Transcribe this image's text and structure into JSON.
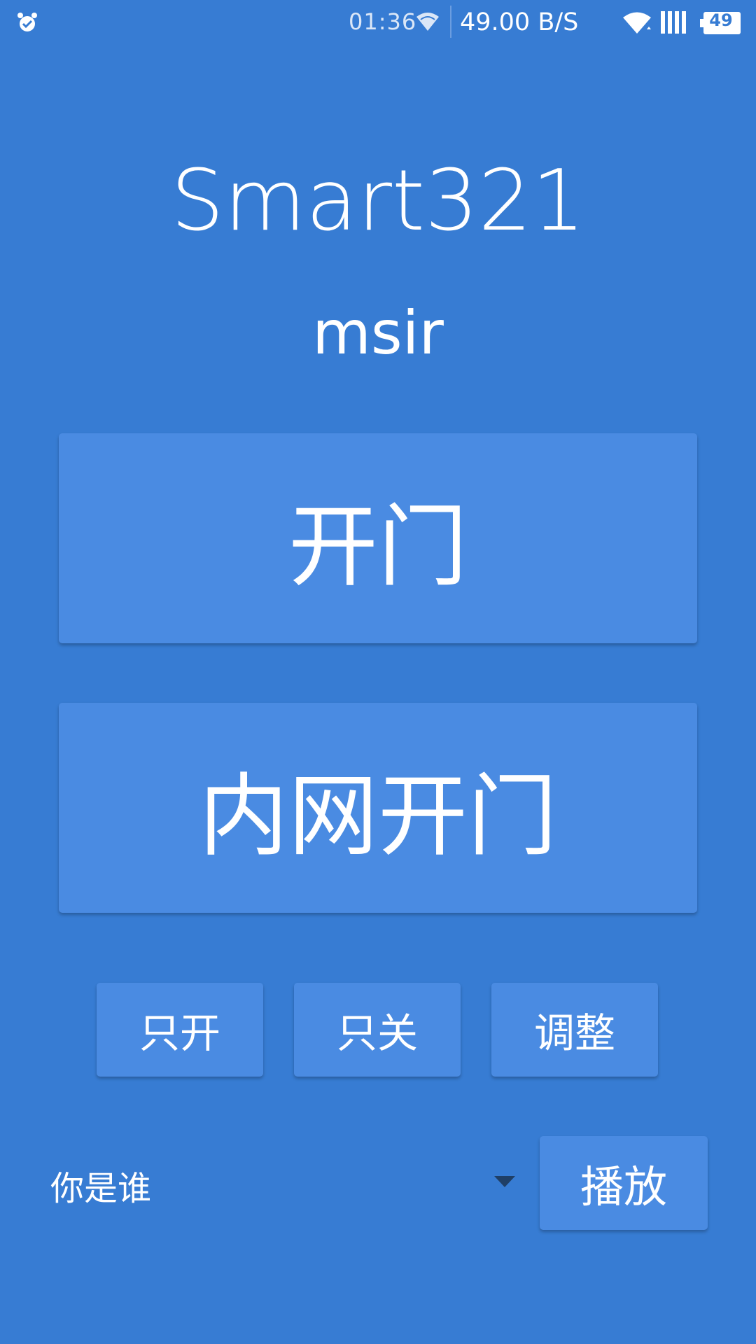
{
  "status_bar": {
    "time": "01:36",
    "network_speed": "49.00 B/S",
    "battery_level": "49",
    "icons": [
      "alarm-icon",
      "wifi-icon",
      "wifi-icon",
      "signal-icon",
      "battery-icon"
    ]
  },
  "header": {
    "title": "Smart321",
    "subtitle": "msir"
  },
  "actions": {
    "open_door": "开门",
    "intranet_open_door": "内网开门",
    "only_open": "只开",
    "only_close": "只关",
    "adjust": "调整"
  },
  "voice": {
    "selected_option": "你是谁",
    "play_label": "播放"
  },
  "colors": {
    "background": "#377cd3",
    "button": "#4a8be2",
    "text": "#ffffff"
  }
}
